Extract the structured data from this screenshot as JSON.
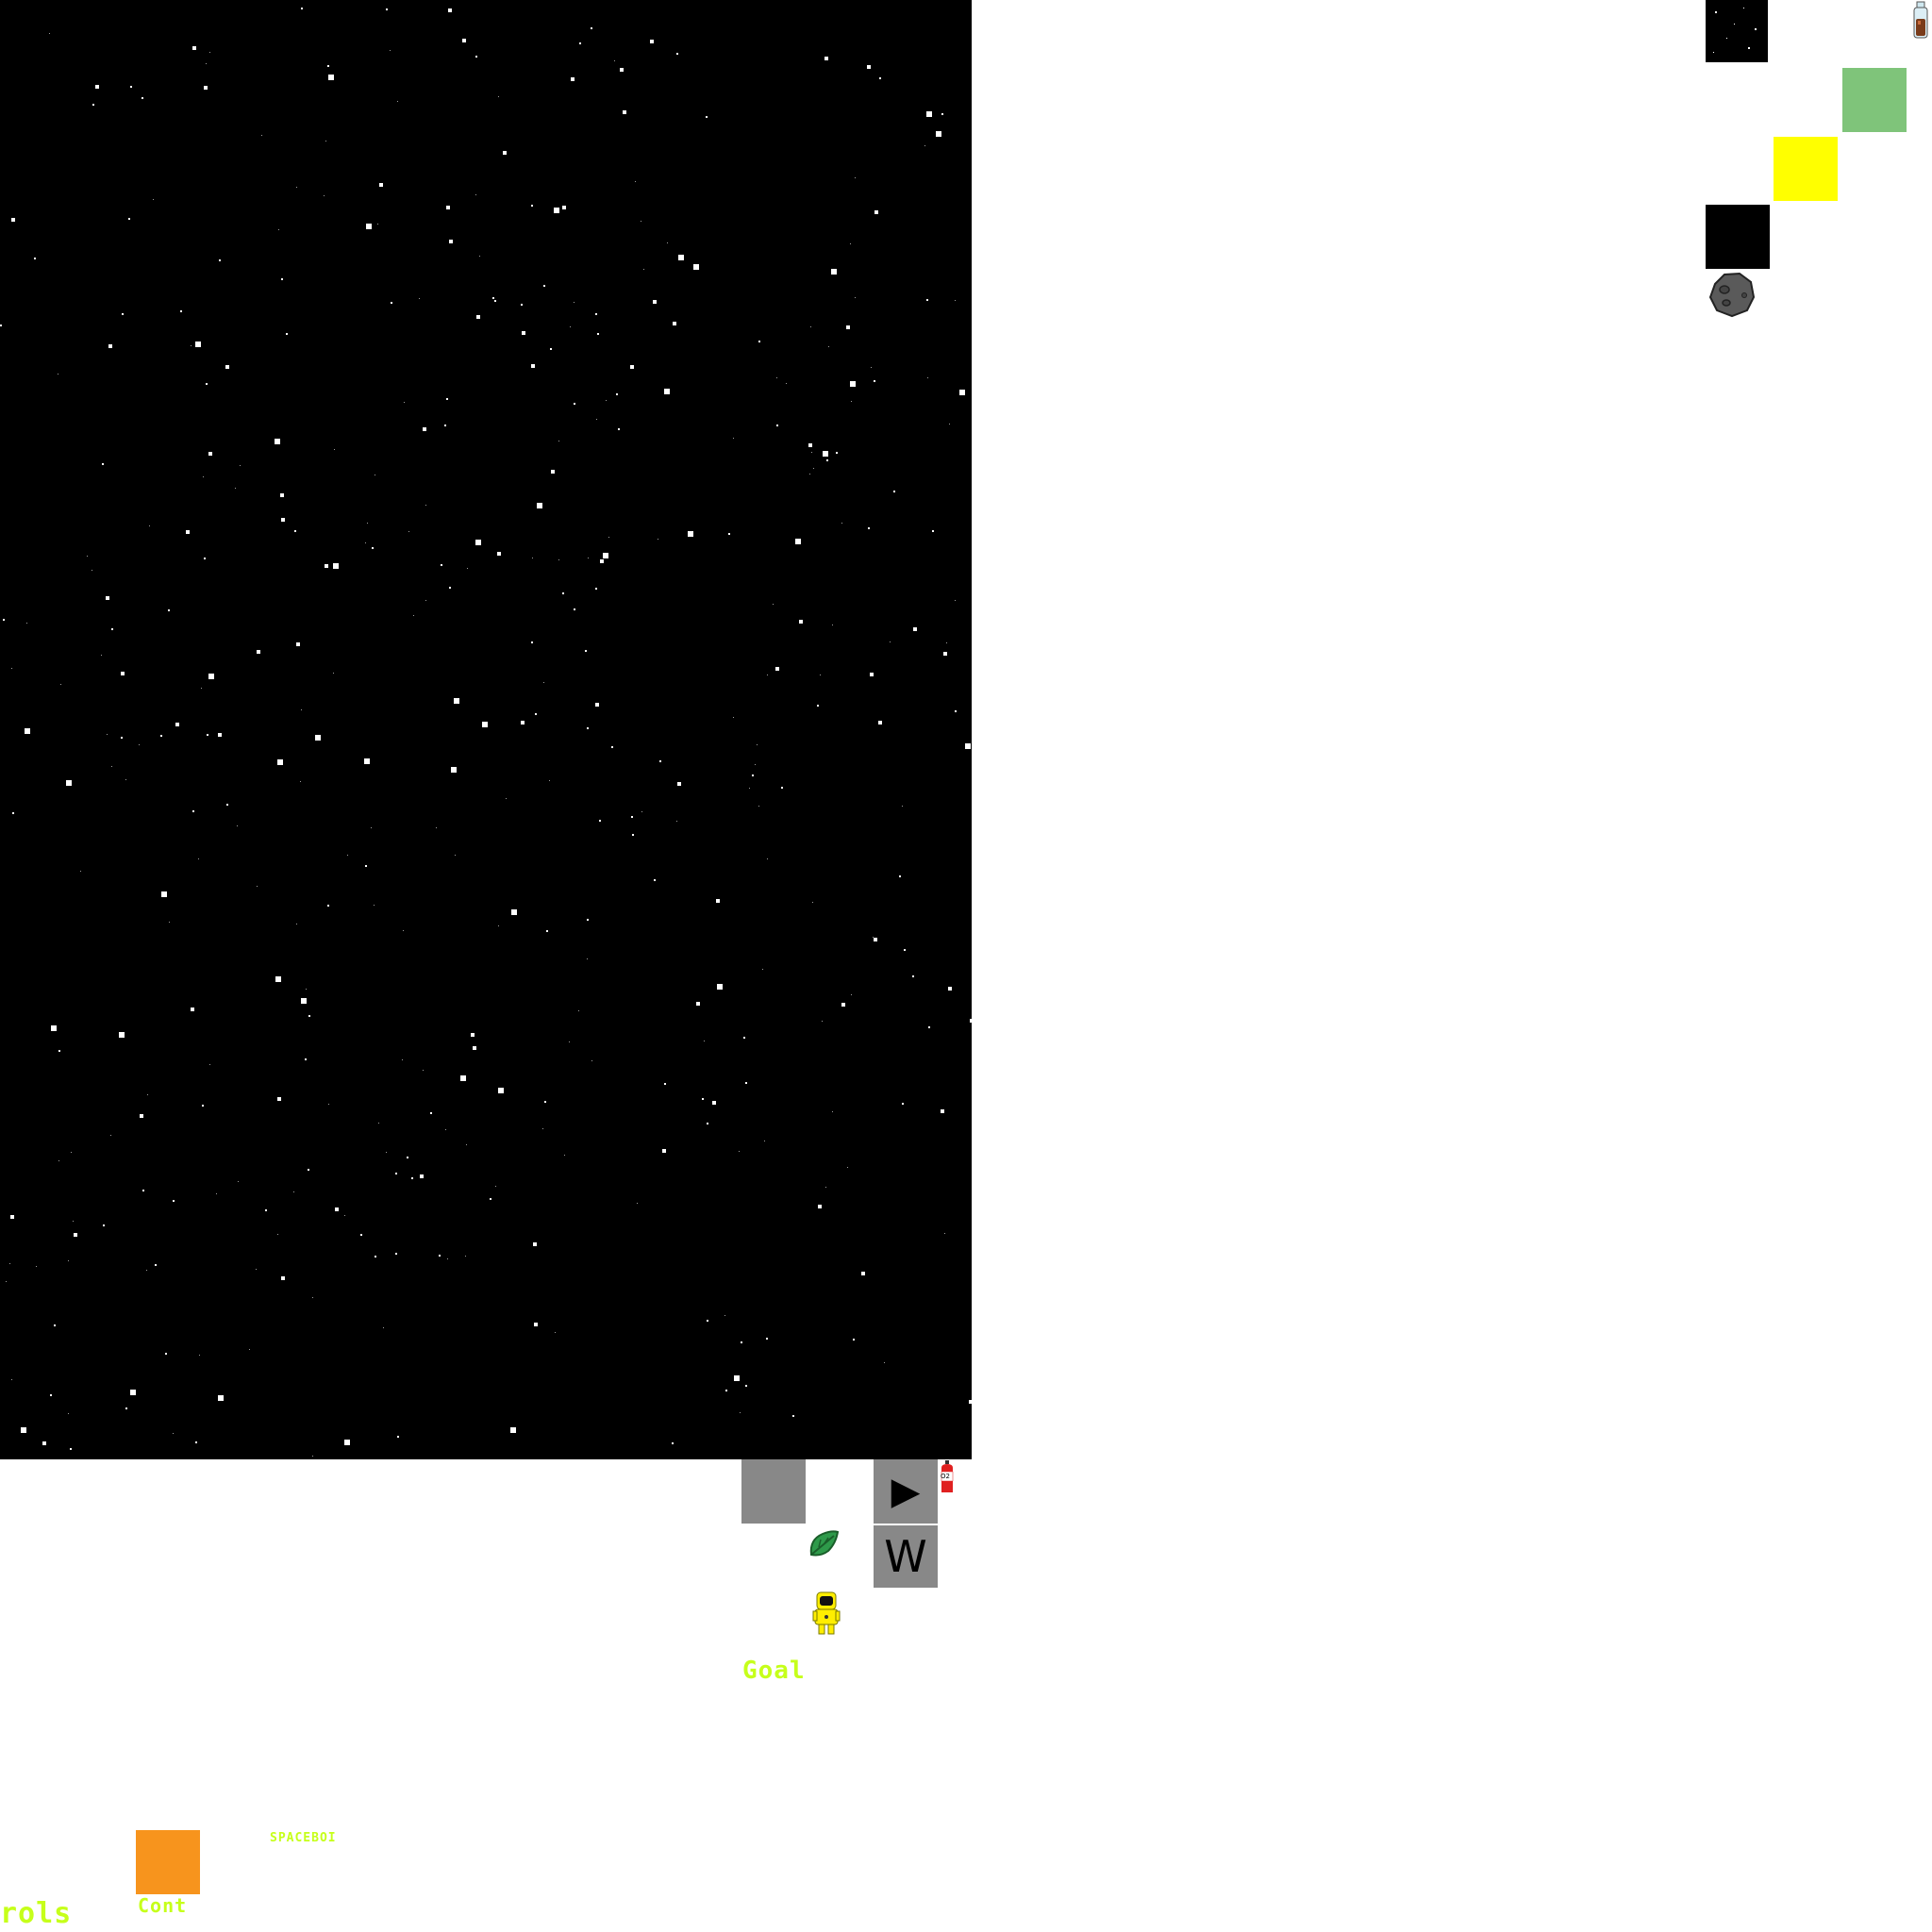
{
  "game": {
    "goal_label": "Goal",
    "controls_partial_label": "rols",
    "cont_label": "Cont",
    "title_label": "SPACEBOI",
    "o2_label": "O2"
  },
  "buttons": {
    "play_glyph": "▶",
    "w_key_glyph": "W"
  },
  "palette": {
    "space": "#000000",
    "green_tile": "#7fc47a",
    "yellow_tile": "#ffff00",
    "black_tile": "#000000",
    "orange_tile": "#f7941d",
    "gray_button": "#888888",
    "label_yellow": "#c6ff1a"
  },
  "icons": {
    "player": "astronaut-icon",
    "collectible": "leaf-icon",
    "oxygen": "oxygen-tank-icon",
    "hazard": "asteroid-icon",
    "potion": "potion-bottle-icon"
  }
}
